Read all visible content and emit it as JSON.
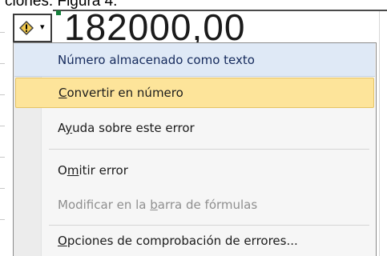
{
  "document": {
    "caption": "ciones. Figura 4."
  },
  "cell": {
    "value": "182000,00"
  },
  "smart_tag": {
    "icon": "warning-diamond-icon",
    "arrow_icon": "dropdown-arrow-icon",
    "arrow_glyph": "▾",
    "diamond_color": "#f2c94c"
  },
  "menu": {
    "header": "Número almacenado como texto",
    "items": [
      {
        "before": "",
        "accel": "C",
        "after": "onvertir en número",
        "state": "highlighted"
      },
      {
        "before": "A",
        "accel": "y",
        "after": "uda sobre este error",
        "state": "normal"
      },
      {
        "before": "O",
        "accel": "m",
        "after": "itir error",
        "state": "normal"
      },
      {
        "before": "Modificar en la ",
        "accel": "b",
        "after": "arra de fórmulas",
        "state": "disabled"
      },
      {
        "before": "",
        "accel": "O",
        "after": "pciones de comprobación de errores...",
        "state": "normal"
      }
    ]
  },
  "colors": {
    "highlight": "#fde49a",
    "header_bg": "#dfe9f6",
    "header_text": "#14295b"
  }
}
